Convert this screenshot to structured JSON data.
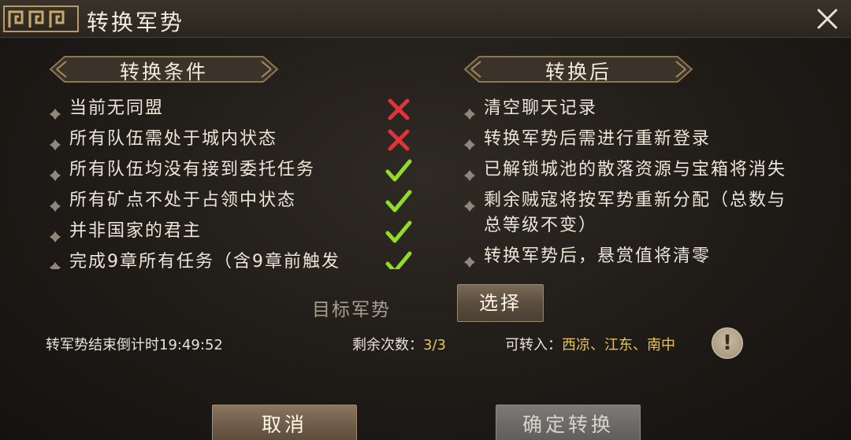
{
  "window": {
    "title": "转换军势",
    "close_icon": "close-icon"
  },
  "conditions": {
    "header": "转换条件",
    "items": [
      {
        "label": "当前无同盟",
        "status": "fail"
      },
      {
        "label": "所有队伍需处于城内状态",
        "status": "fail"
      },
      {
        "label": "所有队伍均没有接到委托任务",
        "status": "pass"
      },
      {
        "label": "所有矿点不处于占领中状态",
        "status": "pass"
      },
      {
        "label": "并非国家的君主",
        "status": "pass"
      },
      {
        "label": "完成9章所有任务（含9章前触发",
        "status": "pass"
      }
    ]
  },
  "after": {
    "header": "转换后",
    "items": [
      {
        "label": "清空聊天记录"
      },
      {
        "label": "转换军势后需进行重新登录"
      },
      {
        "label": "已解锁城池的散落资源与宝箱将消失"
      },
      {
        "label": "剩余贼寇将按军势重新分配（总数与总等级不变）"
      },
      {
        "label": "转换军势后，悬赏值将清零"
      }
    ]
  },
  "target": {
    "label": "目标军势",
    "select_label": "选择"
  },
  "status": {
    "countdown_label": "转军势结束倒计时",
    "countdown_value": "19:49:52",
    "remaining_label": "剩余次数：",
    "remaining_value": "3/3",
    "transfer_label": "可转入：",
    "transfer_value": "西凉、江东、南中",
    "info_symbol": "!"
  },
  "buttons": {
    "cancel": "取消",
    "confirm": "确定转换"
  },
  "colors": {
    "pass": "#8fdc2a",
    "fail": "#e2333a",
    "highlight": "#e4c35a"
  }
}
